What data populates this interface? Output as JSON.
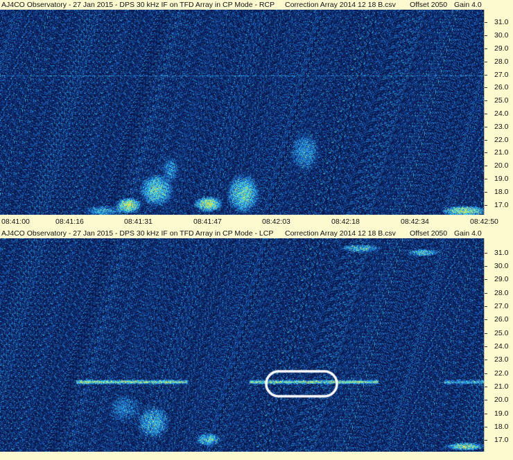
{
  "colors": {
    "background": "#fdfad0",
    "spectrogram_base": "#12338a",
    "noise_dark": "#0a1f5c",
    "noise_mid": "#2a6fd6",
    "noise_bright": "#4fd0e8",
    "signal_hot": "#c8f060",
    "highlight_ring": "#ffffff"
  },
  "panels": [
    {
      "title": "AJ4CO Observatory - 27 Jan 2015 - DPS 30 kHz IF on TFD Array in CP Mode - RCP",
      "correction": "Correction Array 2014 12 18 B.csv",
      "offset": "Offset 2050",
      "gain": "Gain 4.0",
      "frequency_labels": [
        "31.0",
        "30.0",
        "29.0",
        "28.0",
        "27.0",
        "26.0",
        "25.0",
        "24.0",
        "23.0",
        "22.0",
        "21.0",
        "20.0",
        "19.0",
        "18.0",
        "17.0"
      ],
      "time_labels": [
        "08:41:00",
        "08:41:16",
        "08:41:31",
        "08:41:47",
        "08:42:03",
        "08:42:18",
        "08:42:34",
        "08:42:50"
      ]
    },
    {
      "title": "AJ4CO Observatory - 27 Jan 2015 - DPS 30 kHz IF on TFD Array in CP Mode - LCP",
      "correction": "Correction Array 2014 12 18 B.csv",
      "offset": "Offset 2050",
      "gain": "Gain 4.0",
      "frequency_labels": [
        "31.0",
        "30.0",
        "29.0",
        "28.0",
        "27.0",
        "26.0",
        "25.0",
        "24.0",
        "23.0",
        "22.0",
        "21.0",
        "20.0",
        "19.0",
        "18.0",
        "17.0"
      ]
    }
  ]
}
